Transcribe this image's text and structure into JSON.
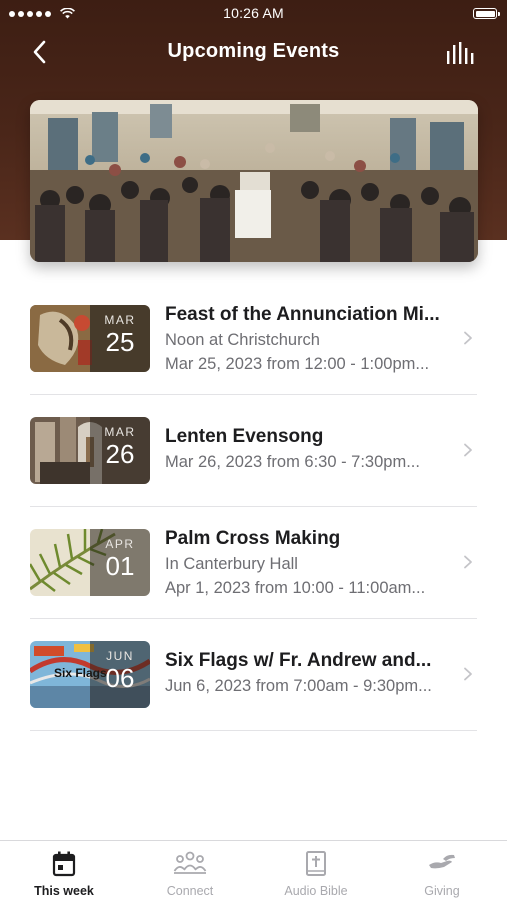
{
  "status_bar": {
    "time": "10:26 AM",
    "signal_icon": "signal-dots-icon",
    "wifi_icon": "wifi-icon",
    "battery_icon": "battery-icon"
  },
  "nav": {
    "title": "Upcoming Events",
    "back_icon": "chevron-left-icon",
    "action_icon": "audio-bars-icon"
  },
  "hero": {
    "image": "congregation-gathering-photo"
  },
  "events": [
    {
      "title": "Feast of the Annunciation Mi...",
      "location": "Noon at Christchurch",
      "when": "Mar 25, 2023 from 12:00 - 1:00pm...",
      "month": "MAR",
      "day": "25"
    },
    {
      "title": "Lenten Evensong",
      "location": "",
      "when": "Mar 26, 2023 from 6:30 - 7:30pm...",
      "month": "MAR",
      "day": "26"
    },
    {
      "title": "Palm Cross Making",
      "location": "In Canterbury Hall",
      "when": "Apr 1, 2023 from 10:00 - 11:00am...",
      "month": "APR",
      "day": "01"
    },
    {
      "title": "Six Flags w/ Fr. Andrew and...",
      "location": "",
      "when": "Jun 6, 2023 from 7:00am - 9:30pm...",
      "month": "JUN",
      "day": "06"
    }
  ],
  "thumb_logo_text": "Six Flags",
  "tabs": [
    {
      "label": "This week",
      "icon": "calendar-icon",
      "active": true
    },
    {
      "label": "Connect",
      "icon": "people-icon",
      "active": false
    },
    {
      "label": "Audio Bible",
      "icon": "bible-icon",
      "active": false
    },
    {
      "label": "Giving",
      "icon": "giving-hand-icon",
      "active": false
    }
  ],
  "colors": {
    "header": "#4a2619",
    "text_primary": "#1d1d1f",
    "text_secondary": "#6e6e73",
    "tab_inactive": "#a9a9ae"
  }
}
